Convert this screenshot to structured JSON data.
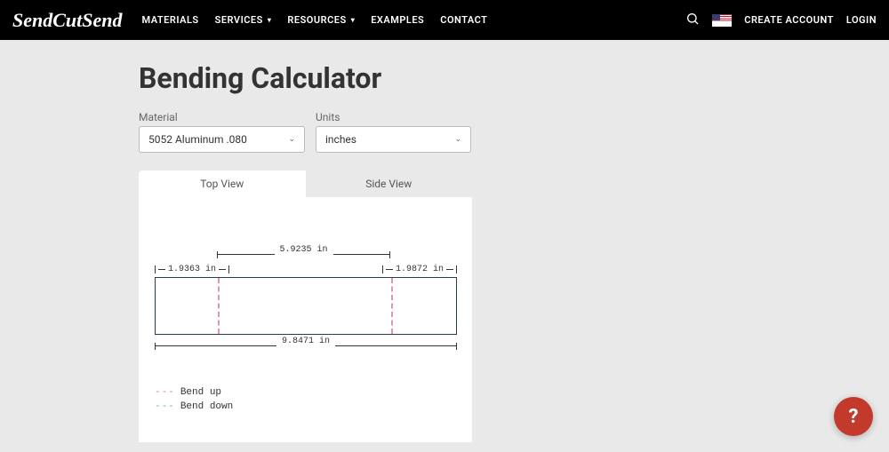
{
  "nav": {
    "logo": "SendCutSend",
    "items": [
      "MATERIALS",
      "SERVICES",
      "RESOURCES",
      "EXAMPLES",
      "CONTACT"
    ],
    "create_account": "CREATE ACCOUNT",
    "login": "LOGIN"
  },
  "page": {
    "title": "Bending Calculator"
  },
  "fields": {
    "material_label": "Material",
    "material_value": "5052 Aluminum .080",
    "units_label": "Units",
    "units_value": "inches"
  },
  "tabs": {
    "top_view": "Top View",
    "side_view": "Side View"
  },
  "dims": {
    "top": "5.9235 in",
    "left": "1.9363 in",
    "right": "1.9872 in",
    "bottom": "9.8471 in"
  },
  "legend": {
    "bend_up": "Bend up",
    "bend_down": "Bend down"
  },
  "help": "?",
  "chart_data": {
    "type": "diagram",
    "view": "Top View",
    "unit": "in",
    "overall_width": 9.8471,
    "segments": [
      {
        "label": "left_flange",
        "length": 1.9363
      },
      {
        "label": "center",
        "length": 5.9235
      },
      {
        "label": "right_flange",
        "length": 1.9872
      }
    ],
    "bend_lines": [
      {
        "position_from_left": 1.9363,
        "direction": "up"
      },
      {
        "position_from_left": 7.8598,
        "direction": "up"
      }
    ],
    "legend": [
      {
        "style": "dashed",
        "color": "#c98888",
        "meaning": "Bend up"
      },
      {
        "style": "dashed",
        "color": "#6bb3b3",
        "meaning": "Bend down"
      }
    ]
  }
}
